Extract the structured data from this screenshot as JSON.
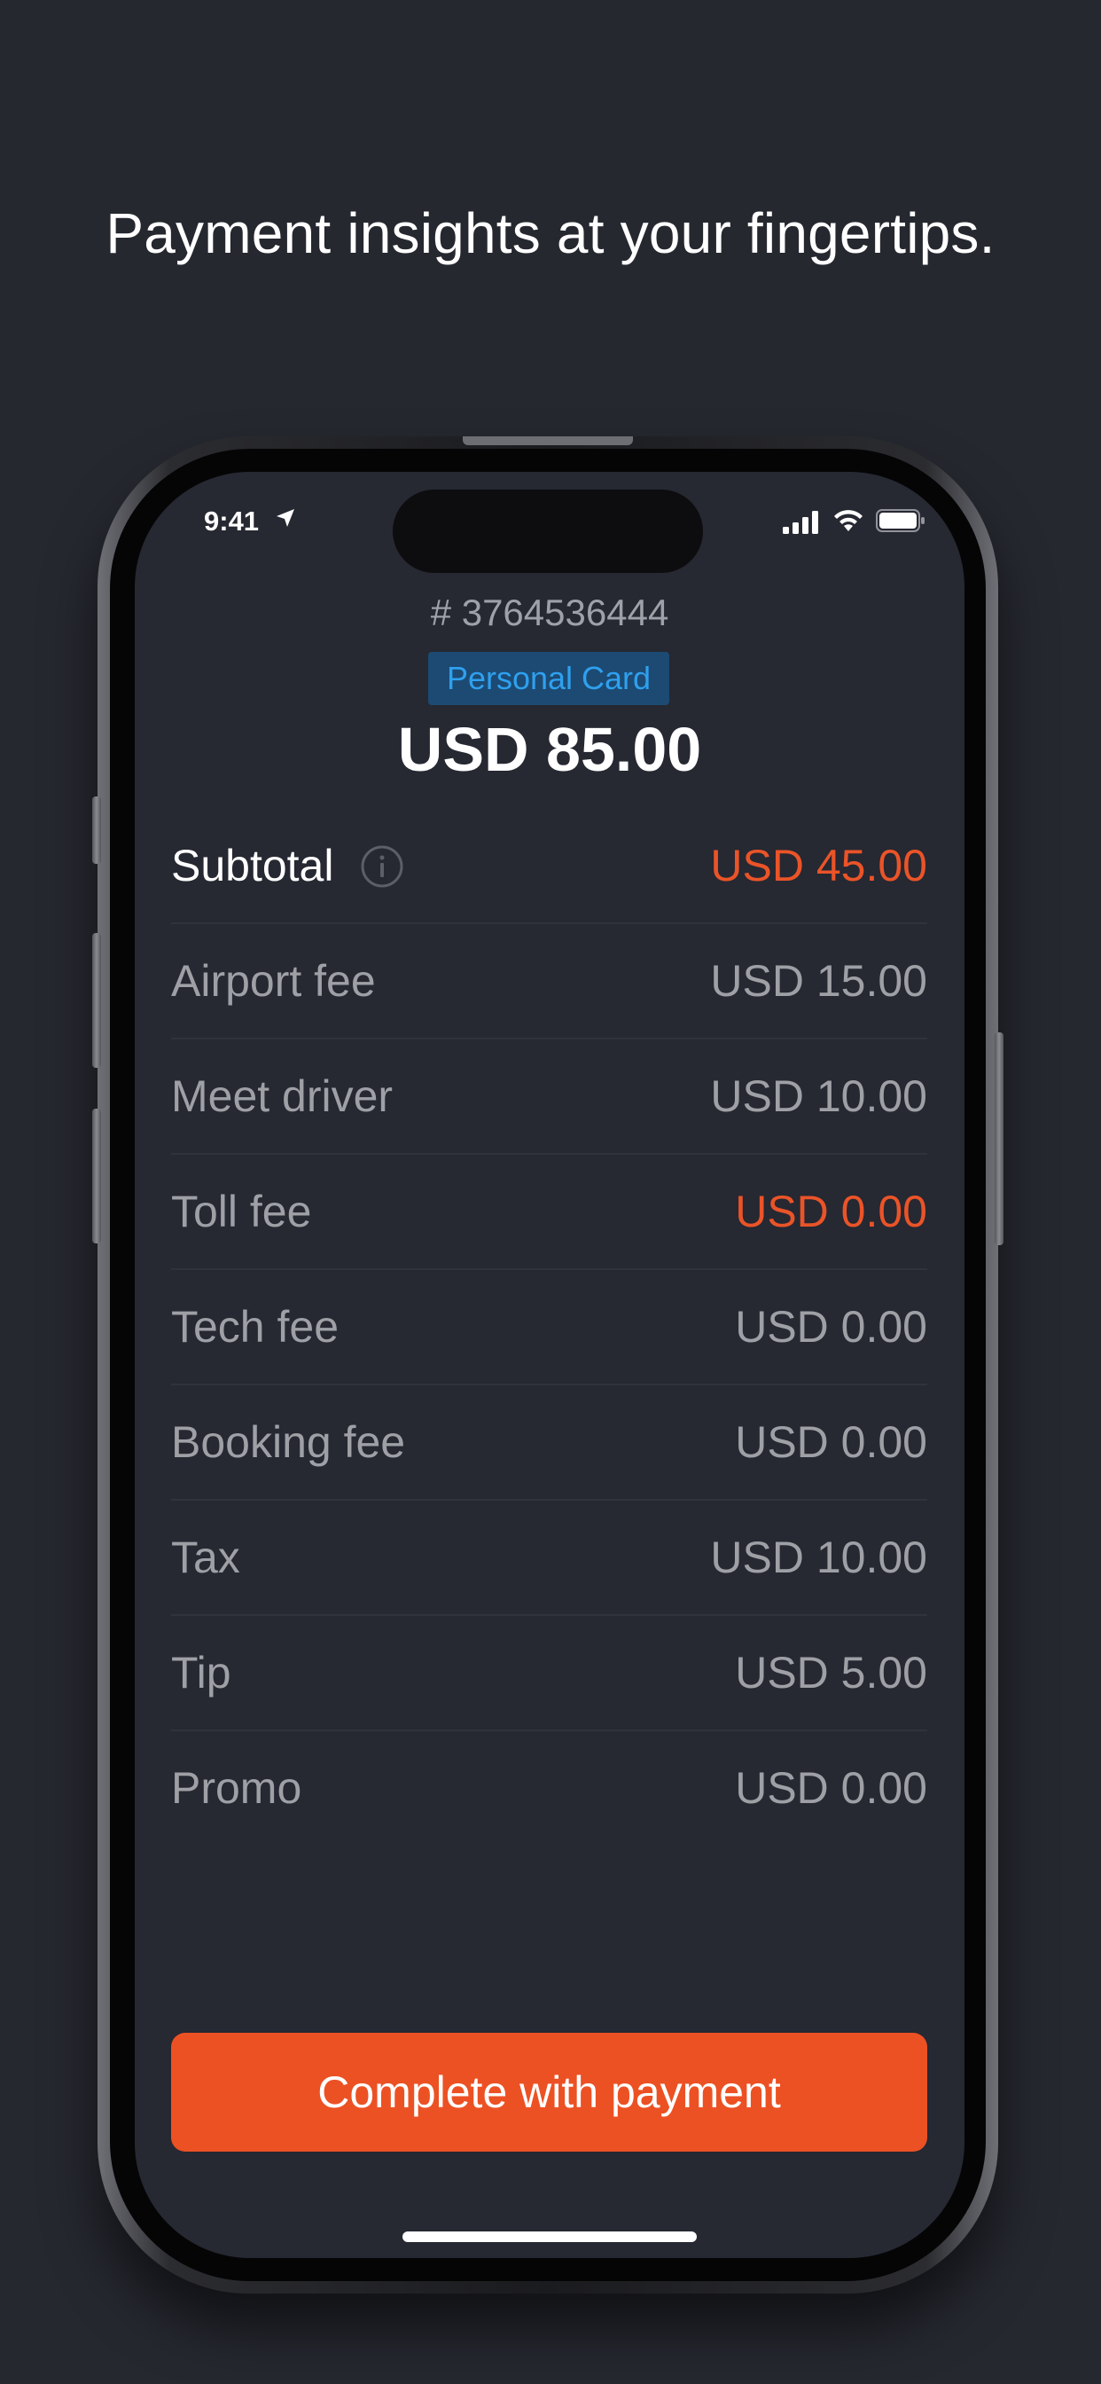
{
  "headline": "Payment insights at your fingertips.",
  "status_bar": {
    "time": "9:41",
    "icons": [
      "location-arrow-icon",
      "signal-icon",
      "wifi-icon",
      "battery-icon"
    ]
  },
  "order": {
    "number": "# 3764536444",
    "card_type": "Personal Card",
    "total": "USD 85.00"
  },
  "fees": [
    {
      "label": "Subtotal",
      "value": "USD 45.00"
    },
    {
      "label": "Airport fee",
      "value": "USD 15.00"
    },
    {
      "label": "Meet driver",
      "value": "USD 10.00"
    },
    {
      "label": "Toll fee",
      "value": "USD 0.00"
    },
    {
      "label": "Tech fee",
      "value": "USD 0.00"
    },
    {
      "label": "Booking fee",
      "value": "USD 0.00"
    },
    {
      "label": "Tax",
      "value": "USD 10.00"
    },
    {
      "label": "Tip",
      "value": "USD 5.00"
    },
    {
      "label": "Promo",
      "value": "USD 0.00"
    }
  ],
  "pay_button": {
    "label": "Complete with payment"
  },
  "colors": {
    "background": "#262830",
    "screen": "#262832",
    "accent": "#ec5124",
    "badge_bg": "#1c4a73",
    "badge_text": "#2fa0ee",
    "muted_text": "#9ea0a6"
  }
}
